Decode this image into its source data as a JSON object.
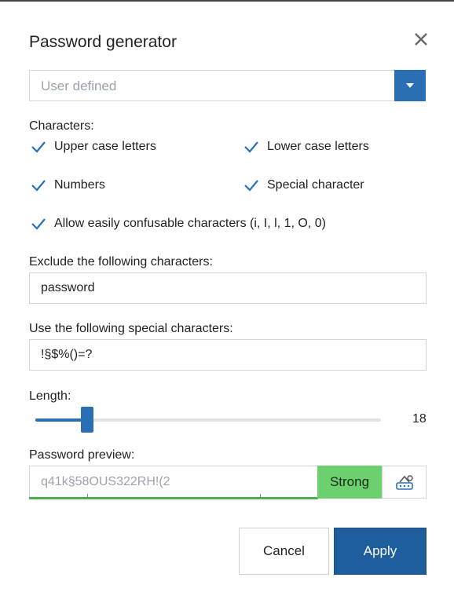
{
  "dialog": {
    "title": "Password generator"
  },
  "mode_select": {
    "selected": "User defined"
  },
  "characters": {
    "heading": "Characters:",
    "options": [
      {
        "label": "Upper case letters",
        "checked": true
      },
      {
        "label": "Lower case letters",
        "checked": true
      },
      {
        "label": "Numbers",
        "checked": true
      },
      {
        "label": "Special character",
        "checked": true
      },
      {
        "label": "Allow easily confusable characters (i, I, l, 1, O, 0)",
        "checked": true
      }
    ]
  },
  "exclude": {
    "label": "Exclude the following characters:",
    "value": "password"
  },
  "special": {
    "label": "Use the following special characters:",
    "value": "!§$%()=?"
  },
  "length": {
    "label": "Length:",
    "value": "18",
    "slider_fraction": 0.15
  },
  "preview": {
    "label": "Password preview:",
    "value": "q41k§58OUS322RH!(2",
    "strength": "Strong"
  },
  "buttons": {
    "cancel": "Cancel",
    "apply": "Apply"
  },
  "colors": {
    "accent": "#2a6fb4",
    "apply_bg": "#1f5e9c",
    "strength_bg": "#6cd06e",
    "check": "#2a6fb4"
  },
  "icons": {
    "close": "close-icon",
    "dropdown": "chevron-down-icon",
    "generate": "generate-password-icon"
  }
}
